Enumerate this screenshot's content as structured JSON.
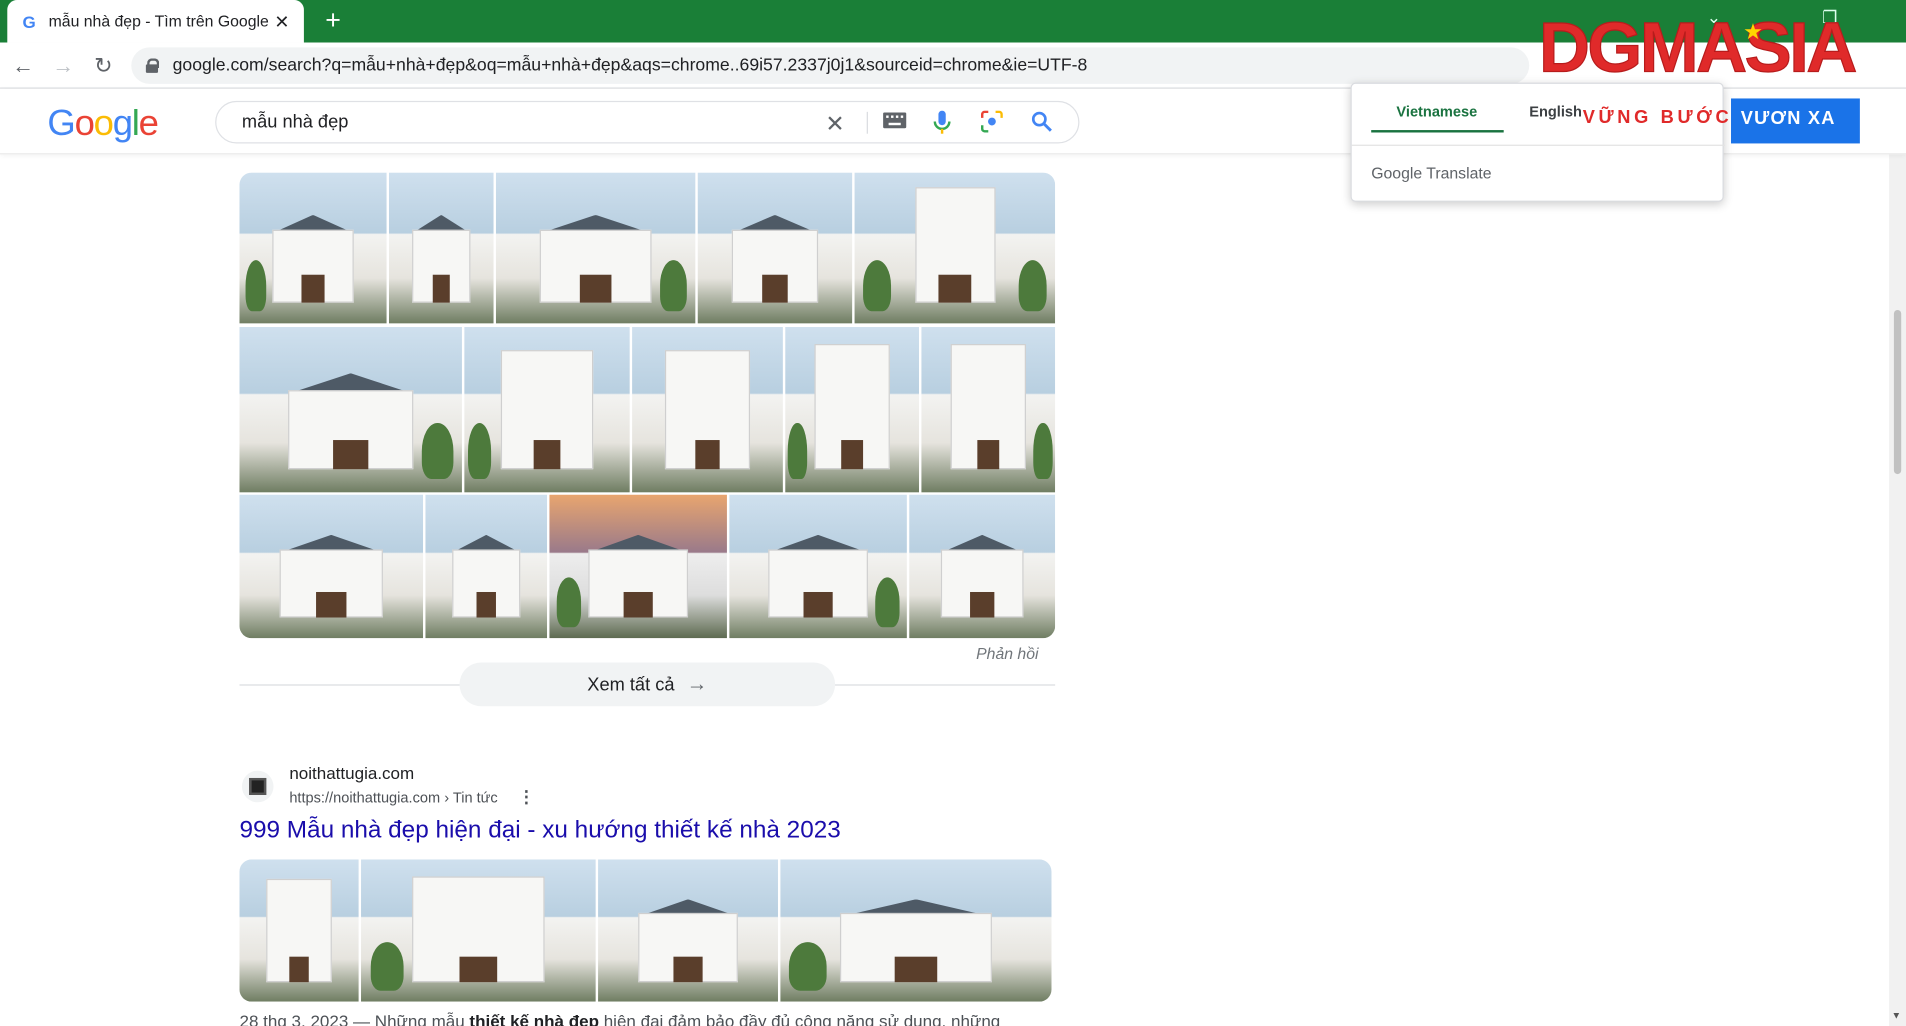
{
  "browser": {
    "tab_title": "mẫu nhà đẹp - Tìm trên Google",
    "tab_favicon": "G",
    "tab_close": "✕",
    "new_tab": "+",
    "url": "google.com/search?q=mẫu+nhà+đẹp&oq=mẫu+nhà+đẹp&aqs=chrome..69i57.2337j0j1&sourceid=chrome&ie=UTF-8",
    "back": "←",
    "forward": "→",
    "reload": "↻"
  },
  "google": {
    "logo": [
      "G",
      "o",
      "o",
      "g",
      "l",
      "e"
    ],
    "query": "mẫu nhà đẹp",
    "clear_icon": "✕",
    "search_icon": "⚲"
  },
  "images": {
    "feedback": "Phản hồi",
    "see_all": "Xem tất cả",
    "see_all_arrow": "→"
  },
  "result": {
    "site_name": "noithattugia.com",
    "site_url": "https://noithattugia.com › Tin tức",
    "menu": "⋮",
    "title": "999 Mẫu nhà đẹp hiện đại - xu hướng thiết kế nhà 2023",
    "snippet_date": "28 thg 3, 2023",
    "snippet_pre": " — Những mẫu ",
    "snippet_bold": "thiết kế nhà đẹp",
    "snippet_post": " hiện đại đảm bảo đầy đủ công năng sử dụng, những"
  },
  "translate": {
    "lang_from": "Vietnamese",
    "lang_to": "English",
    "brand": "Google Translate"
  },
  "watermark": {
    "logo": "DGMASIA",
    "slogan_a": "VỮNG BƯỚC",
    "slogan_b": "VƯƠN XA"
  },
  "colors": {
    "tabstrip": "#1a7f37",
    "link": "#1a0dab",
    "translate_accent": "#1a7340"
  }
}
